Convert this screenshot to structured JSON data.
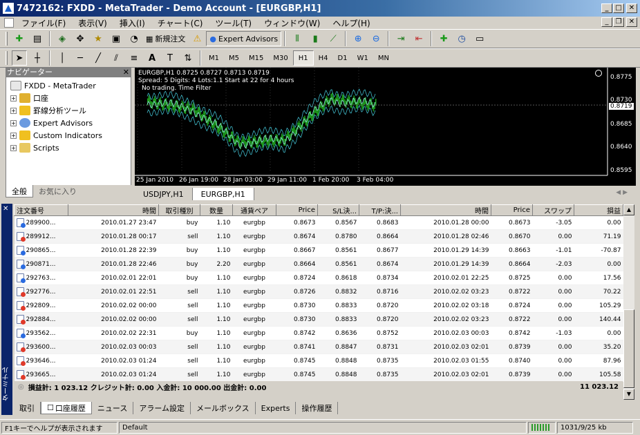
{
  "window": {
    "title": "7472162: FXDD - MetaTrader - Demo Account - [EURGBP,H1]"
  },
  "menu": [
    "ファイル(F)",
    "表示(V)",
    "挿入(I)",
    "チャート(C)",
    "ツール(T)",
    "ウィンドウ(W)",
    "ヘルプ(H)"
  ],
  "toolbar": {
    "new_order": "新規注文",
    "expert_advisors": "Expert Advisors"
  },
  "timeframes": [
    "M1",
    "M5",
    "M15",
    "M30",
    "H1",
    "H4",
    "D1",
    "W1",
    "MN"
  ],
  "timeframe_selected": "H1",
  "navigator": {
    "title": "ナビゲーター",
    "root": "FXDD - MetaTrader",
    "items": [
      "口座",
      "罫線分析ツール",
      "Expert Advisors",
      "Custom Indicators",
      "Scripts"
    ],
    "tabs": [
      "全般",
      "お気に入り"
    ]
  },
  "chart": {
    "header": "EURGBP,H1  0.8725 0.8727 0.8713 0.8719",
    "line2": "Spread: 5  Digits: 4  Lots:1.1  Start at 22 for 4 hours",
    "line3": "No trading. Time Filter",
    "current_price": "0.8719",
    "price_ticks": [
      "0.8775",
      "0.8730",
      "0.8685",
      "0.8640",
      "0.8595"
    ],
    "time_ticks": [
      "25 Jan 2010",
      "26 Jan 19:00",
      "28 Jan 03:00",
      "29 Jan 11:00",
      "1 Feb 20:00",
      "3 Feb 04:00"
    ],
    "tabs": [
      "USDJPY,H1",
      "EURGBP,H1"
    ],
    "tab_selected": "EURGBP,H1"
  },
  "chart_data": {
    "type": "line",
    "title": "EURGBP,H1",
    "ylim": [
      0.8595,
      0.8775
    ],
    "x": [
      "25 Jan 2010",
      "26 Jan 19:00",
      "28 Jan 03:00",
      "29 Jan 11:00",
      "1 Feb 20:00",
      "3 Feb 04:00"
    ],
    "series": [
      {
        "name": "EURGBP,H1",
        "values": [
          0.8725,
          0.8712,
          0.865,
          0.8655,
          0.873,
          0.8719
        ]
      }
    ],
    "grid": true
  },
  "terminal": {
    "side_label": "ターミナル",
    "columns": [
      "注文番号",
      "時間",
      "取引種別",
      "数量",
      "通貨ペア",
      "Price",
      "S/L決...",
      "T/P:決...",
      "時間",
      "Price",
      "スワップ",
      "損益"
    ],
    "rows": [
      [
        "289900...",
        "2010.01.27 23:47",
        "buy",
        "1.10",
        "eurgbp",
        "0.8673",
        "0.8567",
        "0.8683",
        "2010.01.28 00:00",
        "0.8673",
        "-3.05",
        "0.00"
      ],
      [
        "289912...",
        "2010.01.28 00:17",
        "sell",
        "1.10",
        "eurgbp",
        "0.8674",
        "0.8780",
        "0.8664",
        "2010.01.28 02:46",
        "0.8670",
        "0.00",
        "71.19"
      ],
      [
        "290865...",
        "2010.01.28 22:39",
        "buy",
        "1.10",
        "eurgbp",
        "0.8667",
        "0.8561",
        "0.8677",
        "2010.01.29 14:39",
        "0.8663",
        "-1.01",
        "-70.87"
      ],
      [
        "290871...",
        "2010.01.28 22:46",
        "buy",
        "2.20",
        "eurgbp",
        "0.8664",
        "0.8561",
        "0.8674",
        "2010.01.29 14:39",
        "0.8664",
        "-2.03",
        "0.00"
      ],
      [
        "292763...",
        "2010.02.01 22:01",
        "buy",
        "1.10",
        "eurgbp",
        "0.8724",
        "0.8618",
        "0.8734",
        "2010.02.01 22:25",
        "0.8725",
        "0.00",
        "17.56"
      ],
      [
        "292776...",
        "2010.02.01 22:51",
        "sell",
        "1.10",
        "eurgbp",
        "0.8726",
        "0.8832",
        "0.8716",
        "2010.02.02 03:23",
        "0.8722",
        "0.00",
        "70.22"
      ],
      [
        "292809...",
        "2010.02.02 00:00",
        "sell",
        "1.10",
        "eurgbp",
        "0.8730",
        "0.8833",
        "0.8720",
        "2010.02.02 03:18",
        "0.8724",
        "0.00",
        "105.29"
      ],
      [
        "292884...",
        "2010.02.02 00:00",
        "sell",
        "1.10",
        "eurgbp",
        "0.8730",
        "0.8833",
        "0.8720",
        "2010.02.02 03:23",
        "0.8722",
        "0.00",
        "140.44"
      ],
      [
        "293562...",
        "2010.02.02 22:31",
        "buy",
        "1.10",
        "eurgbp",
        "0.8742",
        "0.8636",
        "0.8752",
        "2010.02.03 00:03",
        "0.8742",
        "-1.03",
        "0.00"
      ],
      [
        "293600...",
        "2010.02.03 00:03",
        "sell",
        "1.10",
        "eurgbp",
        "0.8741",
        "0.8847",
        "0.8731",
        "2010.02.03 02:01",
        "0.8739",
        "0.00",
        "35.20"
      ],
      [
        "293646...",
        "2010.02.03 01:24",
        "sell",
        "1.10",
        "eurgbp",
        "0.8745",
        "0.8848",
        "0.8735",
        "2010.02.03 01:55",
        "0.8740",
        "0.00",
        "87.96"
      ],
      [
        "293665...",
        "2010.02.03 01:24",
        "sell",
        "1.10",
        "eurgbp",
        "0.8745",
        "0.8848",
        "0.8735",
        "2010.02.03 02:01",
        "0.8739",
        "0.00",
        "105.58"
      ]
    ],
    "summary": "損益計: 1 023.12  クレジット計: 0.00  入金計: 10 000.00  出金計: 0.00",
    "summary_total": "11 023.12",
    "tabs": [
      "取引",
      "口座履歴",
      "ニュース",
      "アラーム設定",
      "メールボックス",
      "Experts",
      "操作履歴"
    ],
    "tab_selected": "口座履歴"
  },
  "status": {
    "help": "F1キーでヘルプが表示されます",
    "profile": "Default",
    "traffic": "1031/9/25 kb"
  }
}
